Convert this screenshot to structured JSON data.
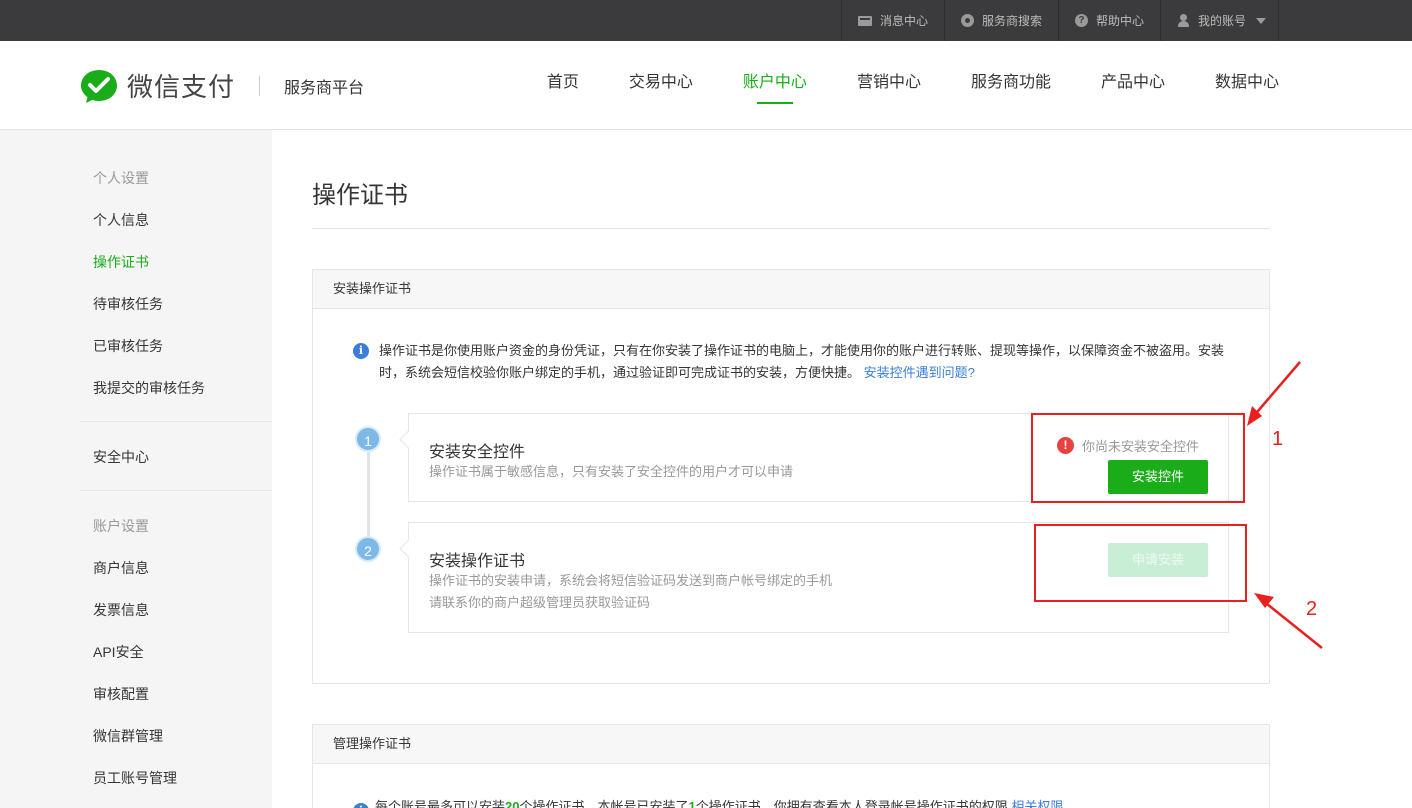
{
  "topbar": {
    "items": [
      {
        "label": "消息中心",
        "icon": "message-icon"
      },
      {
        "label": "服务商搜索",
        "icon": "provider-search-icon"
      },
      {
        "label": "帮助中心",
        "icon": "help-icon"
      },
      {
        "label": "我的账号",
        "icon": "user-icon"
      }
    ]
  },
  "header": {
    "brand": "微信支付",
    "subtitle": "服务商平台",
    "nav": [
      "首页",
      "交易中心",
      "账户中心",
      "营销中心",
      "服务商功能",
      "产品中心",
      "数据中心"
    ],
    "active_nav": "账户中心"
  },
  "sidebar": {
    "group1_title": "个人设置",
    "group1_items": [
      "个人信息",
      "操作证书",
      "待审核任务",
      "已审核任务",
      "我提交的审核任务"
    ],
    "active_item": "操作证书",
    "security": "安全中心",
    "group2_title": "账户设置",
    "group2_items": [
      "商户信息",
      "发票信息",
      "API安全",
      "审核配置",
      "微信群管理",
      "员工账号管理"
    ]
  },
  "main": {
    "title": "操作证书",
    "install_panel": {
      "heading": "安装操作证书",
      "notice": "操作证书是你使用账户资金的身份凭证，只有在你安装了操作证书的电脑上，才能使用你的账户进行转账、提现等操作，以保障资金不被盗用。安装时，系统会短信校验你账户绑定的手机，通过验证即可完成证书的安装，方便快捷。",
      "notice_link": "安装控件遇到问题?",
      "steps": [
        {
          "num": "1",
          "title": "安装安全控件",
          "desc": "操作证书属于敏感信息，只有安装了安全控件的用户才可以申请",
          "warning": "你尚未安装安全控件",
          "button": "安装控件"
        },
        {
          "num": "2",
          "title": "安装操作证书",
          "desc_line1": "操作证书的安装申请，系统会将短信验证码发送到商户帐号绑定的手机",
          "desc_line2": "请联系你的商户超级管理员获取验证码",
          "button": "申请安装"
        }
      ]
    },
    "manage_panel": {
      "heading": "管理操作证书",
      "notice_prefix": "每个账号最多可以安装",
      "max_count": "20",
      "notice_mid": "个操作证书，本帐号已安装了",
      "installed_count": "1",
      "notice_suffix": "个操作证书，你拥有查看本人登录帐号操作证书的权限",
      "notice_link": "相关权限"
    }
  },
  "annotations": {
    "label1": "1",
    "label2": "2",
    "color": "#e8211f"
  },
  "colors": {
    "brand_green": "#1aad19",
    "link_blue": "#3b7ed8",
    "warning_red": "#e64340"
  }
}
